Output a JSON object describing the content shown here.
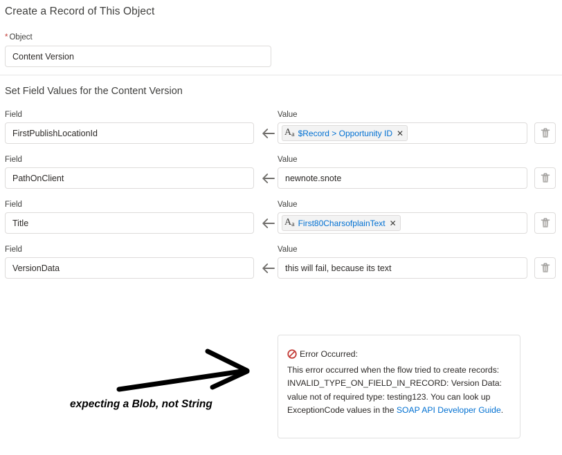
{
  "header": {
    "title": "Create a Record of This Object",
    "object_label": "Object",
    "required_marker": "*",
    "object_value": "Content Version"
  },
  "section": {
    "title": "Set Field Values for the Content Version"
  },
  "labels": {
    "field": "Field",
    "value": "Value"
  },
  "icons": {
    "left_arrow": "arrow-left-icon",
    "trash": "trash-icon",
    "pill_text_type": "Aa",
    "pill_remove": "✕",
    "error_badge": "ban-circle-icon"
  },
  "rows": [
    {
      "field": "FirstPublishLocationId",
      "value_type": "pill",
      "value": "$Record > Opportunity ID"
    },
    {
      "field": "PathOnClient",
      "value_type": "text",
      "value": "newnote.snote"
    },
    {
      "field": "Title",
      "value_type": "pill",
      "value": "First80CharsofplainText"
    },
    {
      "field": "VersionData",
      "value_type": "text",
      "value": "this will fail, because its text"
    }
  ],
  "error": {
    "heading": "Error Occurred:",
    "body_before_link": "This error occurred when the flow tried to create records: INVALID_TYPE_ON_FIELD_IN_RECORD: Version Data: value not of required type: testing123. You can look up ExceptionCode values in the ",
    "link_text": "SOAP API Developer Guide",
    "body_after_link": "."
  },
  "annotation": {
    "caption": "expecting a Blob, not String"
  },
  "colors": {
    "link": "#0070d2",
    "error_red": "#c23934",
    "text": "#3e3e3c",
    "border": "#dddbda"
  }
}
